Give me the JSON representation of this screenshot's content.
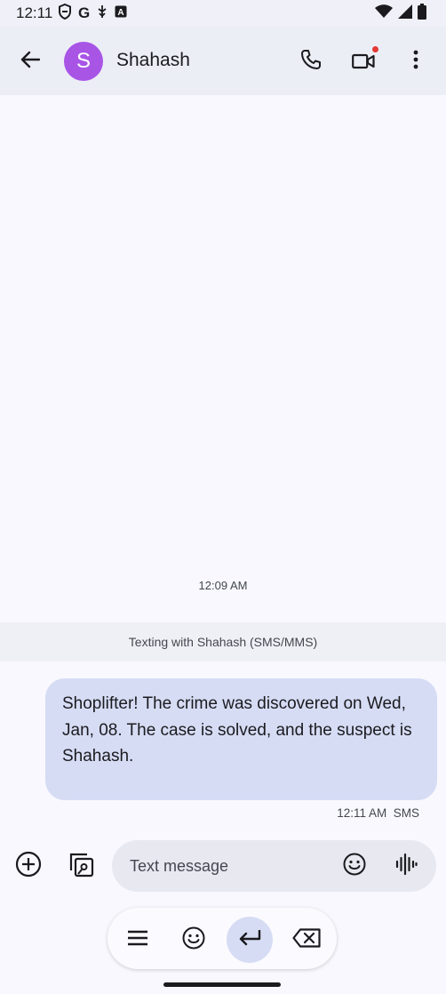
{
  "status_bar": {
    "time": "12:11",
    "left_icons": [
      "shield-icon",
      "google-g-icon",
      "usb-debug-icon",
      "font-a-icon"
    ],
    "right_icons": [
      "wifi-icon",
      "cell-signal-icon",
      "battery-icon"
    ]
  },
  "header": {
    "back_icon": "arrow-back-icon",
    "avatar_letter": "S",
    "avatar_color": "#a855e6",
    "contact_name": "Shahash",
    "actions": [
      "phone-icon",
      "video-call-icon",
      "more-vert-icon"
    ],
    "video_badge_color": "#e53935"
  },
  "conversation": {
    "timestamp": "12:09 AM",
    "banner": "Texting with Shahash (SMS/MMS)",
    "messages": [
      {
        "text": "Shoplifter! The crime was discovered on Wed, Jan, 08. The case is solved, and the suspect is Shahash.",
        "meta": "12:11 AM  SMS"
      }
    ]
  },
  "compose": {
    "add_icon": "add-circle-icon",
    "gallery_icon": "gallery-icon",
    "placeholder": "Text message",
    "emoji_icon": "emoji-icon",
    "voice_icon": "voice-waveform-icon"
  },
  "keyboard_toolbar": {
    "items": [
      "menu-icon",
      "emoji-icon",
      "enter-icon",
      "backspace-icon"
    ],
    "active_index": 2,
    "active_color": "#d6dcf4"
  }
}
